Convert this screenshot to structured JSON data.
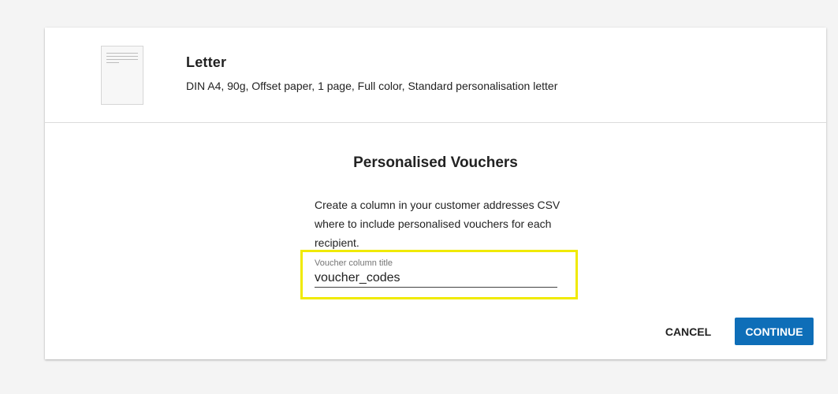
{
  "product": {
    "title": "Letter",
    "description": "DIN A4, 90g, Offset paper, 1 page, Full color, Standard personalisation letter",
    "thumbnail_icon": "document-thumbnail-icon"
  },
  "vouchers": {
    "title": "Personalised Vouchers",
    "instructions": "Create a column in your customer addresses CSV where to include personalised vouchers for each recipient.",
    "field_label": "Voucher column title",
    "field_value": "voucher_codes"
  },
  "actions": {
    "cancel_label": "CANCEL",
    "continue_label": "CONTINUE"
  },
  "colors": {
    "primary": "#0e6eb8",
    "highlight": "#f0ea00",
    "background": "#f4f4f4"
  }
}
